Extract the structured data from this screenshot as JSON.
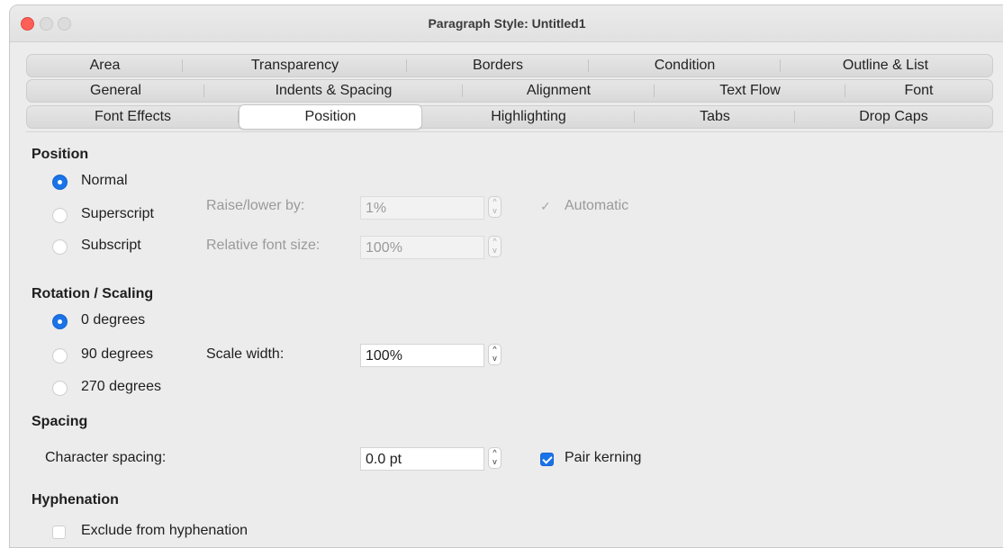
{
  "window": {
    "title": "Paragraph Style: Untitled1"
  },
  "tabs": {
    "row1": [
      "Area",
      "Transparency",
      "Borders",
      "Condition",
      "Outline & List"
    ],
    "row2": [
      "General",
      "Indents & Spacing",
      "Alignment",
      "Text Flow",
      "Font"
    ],
    "row3": [
      "Font Effects",
      "Position",
      "Highlighting",
      "Tabs",
      "Drop Caps"
    ],
    "active": "Position"
  },
  "position": {
    "heading": "Position",
    "options": [
      "Normal",
      "Superscript",
      "Subscript"
    ],
    "selected": "Normal",
    "raise_label": "Raise/lower by:",
    "raise_value": "1%",
    "automatic_label": "Automatic",
    "relsize_label": "Relative font size:",
    "relsize_value": "100%"
  },
  "rotation": {
    "heading": "Rotation / Scaling",
    "options": [
      "0 degrees",
      "90 degrees",
      "270 degrees"
    ],
    "selected": "0 degrees",
    "scale_label": "Scale width:",
    "scale_value": "100%"
  },
  "spacing": {
    "heading": "Spacing",
    "char_label": "Character spacing:",
    "char_value": "0.0 pt",
    "pair_kerning_label": "Pair kerning",
    "pair_kerning_checked": true
  },
  "hyphenation": {
    "heading": "Hyphenation",
    "exclude_label": "Exclude from hyphenation",
    "exclude_checked": false
  },
  "colors": {
    "accent": "#1a73e8",
    "close": "#fe5f57"
  }
}
